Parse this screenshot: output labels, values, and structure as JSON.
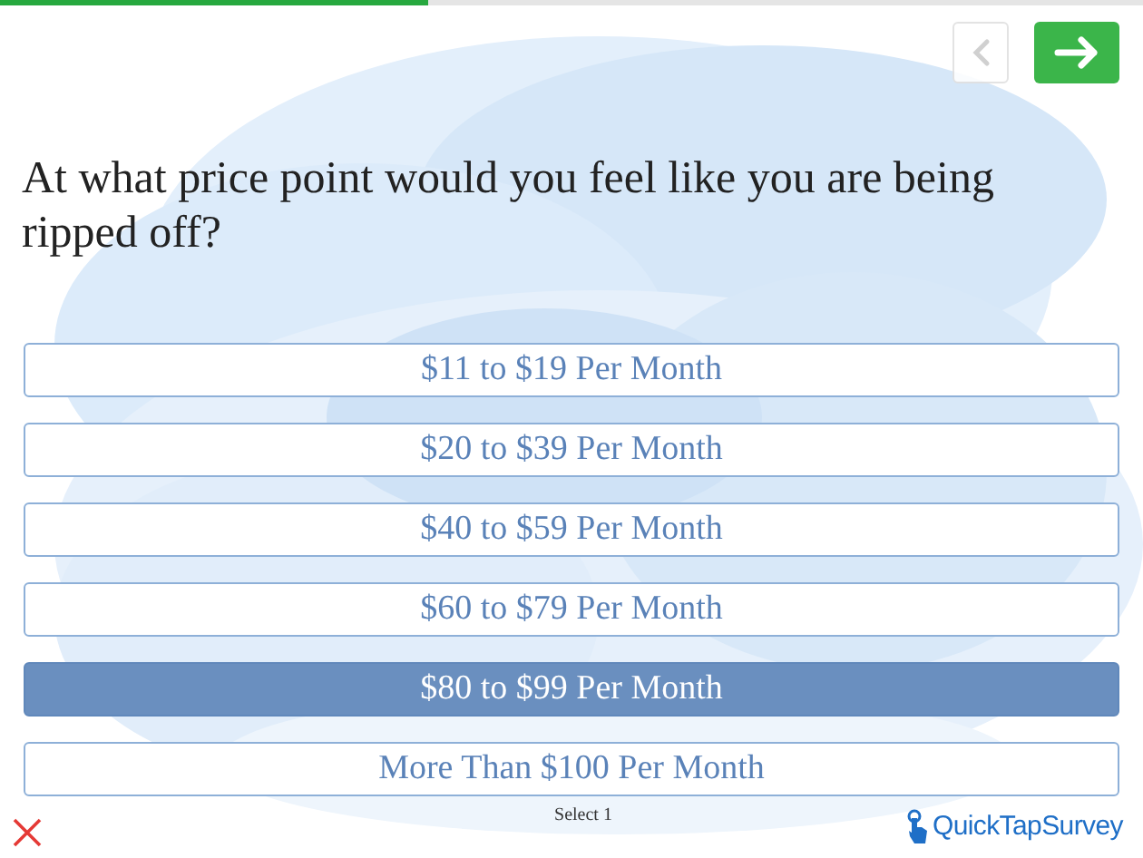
{
  "progress": {
    "level": 0.375
  },
  "navigation": {
    "back_disabled": true
  },
  "question": "At what price point would you feel like you are being ripped off?",
  "options": [
    {
      "label": "$11 to $19 Per Month",
      "selected": false
    },
    {
      "label": "$20 to $39 Per Month",
      "selected": false
    },
    {
      "label": "$40 to $59 Per Month",
      "selected": false
    },
    {
      "label": "$60 to $79 Per Month",
      "selected": false
    },
    {
      "label": "$80 to $99 Per Month",
      "selected": true
    },
    {
      "label": "More Than $100 Per Month",
      "selected": false
    }
  ],
  "hint": "Select 1",
  "logo": "QuickTapSurvey"
}
